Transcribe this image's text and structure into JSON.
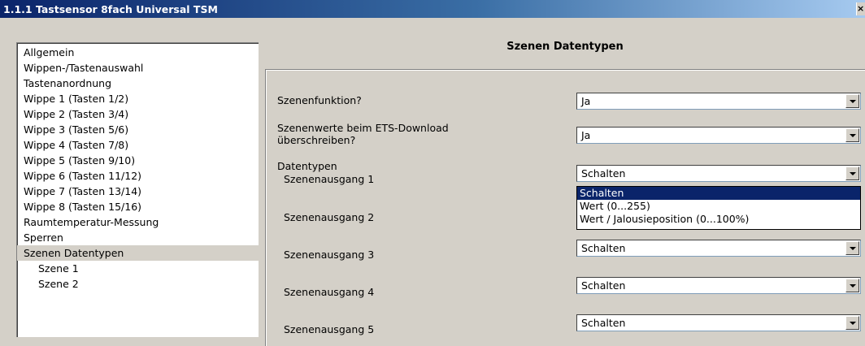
{
  "window": {
    "title": "1.1.1 Tastsensor 8fach Universal TSM",
    "close_glyph": "×"
  },
  "sidebar": {
    "items": [
      {
        "label": "Allgemein"
      },
      {
        "label": "Wippen-/Tastenauswahl"
      },
      {
        "label": "Tastenanordnung"
      },
      {
        "label": "Wippe 1 (Tasten 1/2)"
      },
      {
        "label": "Wippe 2 (Tasten 3/4)"
      },
      {
        "label": "Wippe 3 (Tasten 5/6)"
      },
      {
        "label": "Wippe 4 (Tasten 7/8)"
      },
      {
        "label": "Wippe 5 (Tasten 9/10)"
      },
      {
        "label": "Wippe 6 (Tasten 11/12)"
      },
      {
        "label": "Wippe 7 (Tasten 13/14)"
      },
      {
        "label": "Wippe 8 (Tasten 15/16)"
      },
      {
        "label": "Raumtemperatur-Messung"
      },
      {
        "label": "Sperren"
      },
      {
        "label": "Szenen Datentypen"
      },
      {
        "label": "Szene 1"
      },
      {
        "label": "Szene 2"
      }
    ],
    "selected": "Szenen Datentypen"
  },
  "main": {
    "heading": "Szenen Datentypen",
    "params": {
      "szenenfunktion": {
        "label": "Szenenfunktion?",
        "value": "Ja"
      },
      "szenenwerte": {
        "label_line1": "Szenenwerte beim ETS-Download",
        "label_line2": "überschreiben?",
        "value": "Ja"
      },
      "datentypen": {
        "label": "Datentypen"
      },
      "ausgang1": {
        "label": "Szenenausgang 1",
        "value": "Schalten"
      },
      "ausgang2": {
        "label": "Szenenausgang 2"
      },
      "ausgang3": {
        "label": "Szenenausgang 3",
        "value": "Schalten"
      },
      "ausgang4": {
        "label": "Szenenausgang 4",
        "value": "Schalten"
      },
      "ausgang5": {
        "label": "Szenenausgang 5",
        "value": "Schalten"
      }
    },
    "dropdown_options": [
      "Schalten",
      "Wert (0...255)",
      "Wert / Jalousieposition (0...100%)"
    ]
  }
}
